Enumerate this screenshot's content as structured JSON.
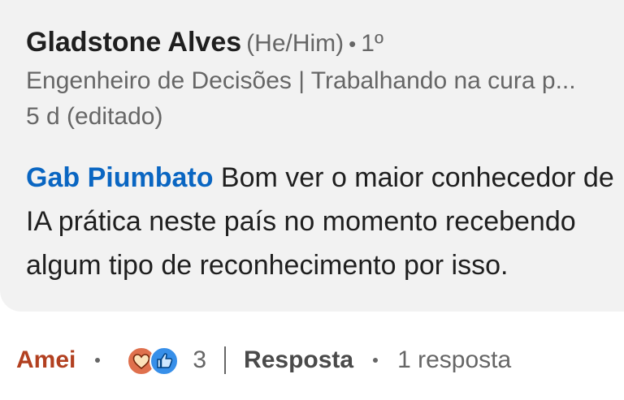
{
  "comment": {
    "author_name": "Gladstone Alves",
    "pronouns": "(He/Him)",
    "separator": "•",
    "connection_degree": "1º",
    "headline": "Engenheiro de Decisões | Trabalhando na cura p...",
    "timestamp": "5 d (editado)",
    "mention": "Gab Piumbato",
    "text_line1": "Bom ver o maior conhecedor de",
    "text_line2": "IA prática neste país no momento recebendo",
    "text_line3": "algum tipo de reconhecimento por isso."
  },
  "actions": {
    "reaction_label": "Amei",
    "reaction_count": "3",
    "reply_label": "Resposta",
    "reply_count": "1 resposta"
  },
  "colors": {
    "mention": "#0a66c2",
    "reaction_label": "#b24020",
    "love_icon_bg": "#df704d",
    "like_icon_bg": "#378fe9",
    "bubble_bg": "#f2f2f2"
  },
  "icons": {
    "love": "heart-icon",
    "like": "thumbs-up-icon"
  }
}
